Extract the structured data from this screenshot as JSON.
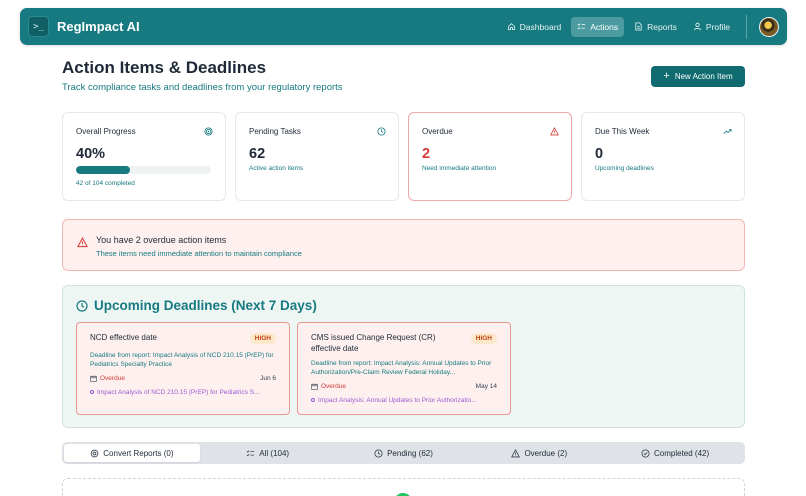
{
  "app": {
    "name": "RegImpact AI",
    "brand_icon": "terminal-icon"
  },
  "nav": {
    "items": [
      {
        "label": "Dashboard",
        "icon": "home-icon",
        "active": false
      },
      {
        "label": "Actions",
        "icon": "list-check-icon",
        "active": true
      },
      {
        "label": "Reports",
        "icon": "document-icon",
        "active": false
      },
      {
        "label": "Profile",
        "icon": "user-icon",
        "active": false
      }
    ]
  },
  "header": {
    "title": "Action Items & Deadlines",
    "subtitle": "Track compliance tasks and deadlines from your regulatory reports",
    "new_button": "New Action Item"
  },
  "stats": [
    {
      "label": "Overall Progress",
      "value": "40%",
      "sub": "42 of 104 completed",
      "icon": "target-icon",
      "progress": 0.4
    },
    {
      "label": "Pending Tasks",
      "value": "62",
      "sub": "Active action items",
      "icon": "clock-icon"
    },
    {
      "label": "Overdue",
      "value": "2",
      "sub": "Need immediate attention",
      "icon": "warning-icon"
    },
    {
      "label": "Due This Week",
      "value": "0",
      "sub": "Upcoming deadlines",
      "icon": "trending-up-icon"
    }
  ],
  "alert": {
    "title": "You have 2 overdue action items",
    "sub": "These items need immediate attention to maintain compliance"
  },
  "upcoming": {
    "title": "Upcoming Deadlines (Next 7 Days)",
    "items": [
      {
        "title": "NCD effective date",
        "badge": "HIGH",
        "desc": "Deadline from report: Impact Analysis of NCD 210.15 (PrEP) for Pediatrics Specialty Practice",
        "status": "Overdue",
        "date": "Jun 6",
        "link": "Impact Analysis of NCD 210.15 (PrEP) for Pediatrics S..."
      },
      {
        "title": "CMS issued Change Request (CR) effective date",
        "badge": "HIGH",
        "desc": "Deadline from report: Impact Analysis: Annual Updates to Prior Authorization/Pre-Claim Review Federal Holiday...",
        "status": "Overdue",
        "date": "May 14",
        "link": "Impact Analysis: Annual Updates to Prior Authorizatio..."
      }
    ]
  },
  "tabs": [
    {
      "label": "Convert Reports (0)",
      "icon": "convert-icon",
      "active": true
    },
    {
      "label": "All (104)",
      "icon": "list-icon",
      "active": false
    },
    {
      "label": "Pending (62)",
      "icon": "clock-icon",
      "active": false
    },
    {
      "label": "Overdue (2)",
      "icon": "warning-icon",
      "active": false
    },
    {
      "label": "Completed (42)",
      "icon": "check-circle-icon",
      "active": false
    }
  ]
}
